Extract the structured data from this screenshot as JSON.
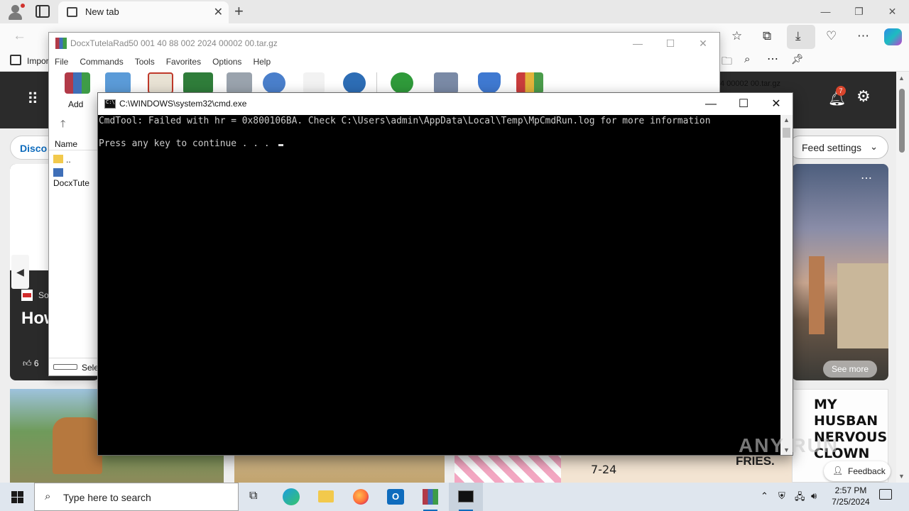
{
  "browser": {
    "tab_title": "New tab",
    "favorites_item": "Impor",
    "discover_label": "Disco",
    "feed_settings_label": "Feed settings",
    "notification_count": "7",
    "card_source": "So",
    "card_headline": "How Me",
    "card_likes": "6",
    "see_more_label": "See more",
    "comic_text": "MY HUSBAN NERVOUS CLOWN",
    "comic_date": "7-24",
    "comic_fries": "FRIES.",
    "feedback_label": "Feedback",
    "side_title_fragment": "4 00002 00.tar.gz"
  },
  "winrar": {
    "title": "DocxTutelaRad50 001 40 88 002 2024 00002 00.tar.gz",
    "menu": [
      "File",
      "Commands",
      "Tools",
      "Favorites",
      "Options",
      "Help"
    ],
    "add_label": "Add",
    "column_name": "Name",
    "rows": [
      "..",
      "DocxTute"
    ],
    "status_text": "Sele"
  },
  "cmd": {
    "title": "C:\\WINDOWS\\system32\\cmd.exe",
    "lines": [
      "CmdTool: Failed with hr = 0x800106BA. Check C:\\Users\\admin\\AppData\\Local\\Temp\\MpCmdRun.log for more information",
      "",
      "Press any key to continue . . . "
    ]
  },
  "taskbar": {
    "search_placeholder": "Type here to search",
    "time": "2:57 PM",
    "date": "7/25/2024"
  },
  "watermark": "ANY RUN"
}
